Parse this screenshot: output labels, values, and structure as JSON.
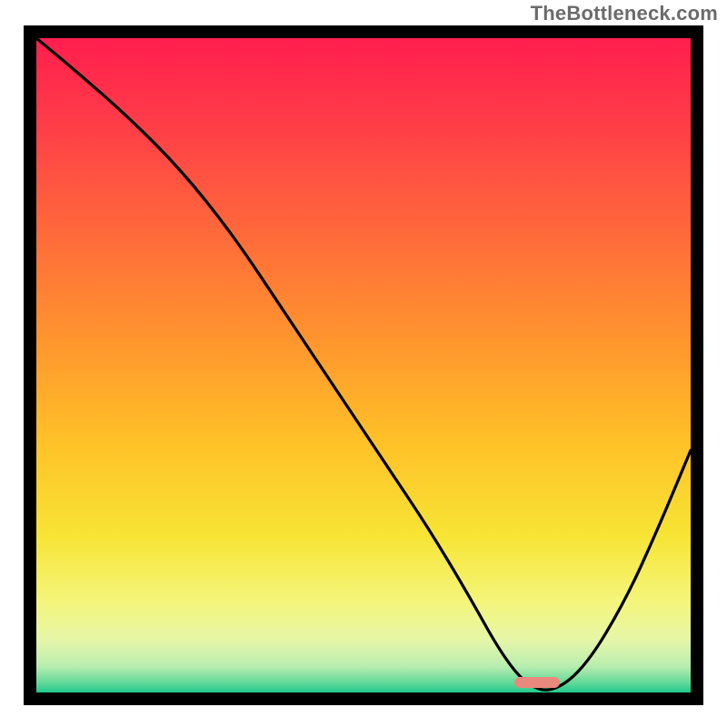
{
  "watermark": "TheBottleneck.com",
  "chart_data": {
    "type": "line",
    "title": "",
    "xlabel": "",
    "ylabel": "",
    "xlim": [
      0,
      100
    ],
    "ylim": [
      0,
      100
    ],
    "grid": false,
    "legend": false,
    "background_gradient": {
      "stops": [
        {
          "pos": 0.0,
          "color": "#ff1e4e"
        },
        {
          "pos": 0.12,
          "color": "#ff3a49"
        },
        {
          "pos": 0.3,
          "color": "#ff6a3a"
        },
        {
          "pos": 0.48,
          "color": "#ff9a2d"
        },
        {
          "pos": 0.62,
          "color": "#ffc228"
        },
        {
          "pos": 0.76,
          "color": "#f7e434"
        },
        {
          "pos": 0.86,
          "color": "#f4f57a"
        },
        {
          "pos": 0.92,
          "color": "#e6f6a8"
        },
        {
          "pos": 0.96,
          "color": "#b8edaf"
        },
        {
          "pos": 0.985,
          "color": "#63d99a"
        },
        {
          "pos": 1.0,
          "color": "#22c98c"
        }
      ]
    },
    "series": [
      {
        "name": "bottleneck-curve",
        "x": [
          0,
          6,
          14,
          22,
          30,
          38,
          46,
          54,
          60,
          66,
          71,
          75,
          79,
          84,
          90,
          95,
          100
        ],
        "y": [
          100,
          95,
          88,
          80,
          70,
          58,
          46,
          34,
          25,
          15,
          6,
          1,
          0,
          4,
          14,
          25,
          37
        ]
      }
    ],
    "marker": {
      "x_start": 73,
      "x_end": 80,
      "y": 0.7,
      "color": "#e9887c"
    }
  }
}
